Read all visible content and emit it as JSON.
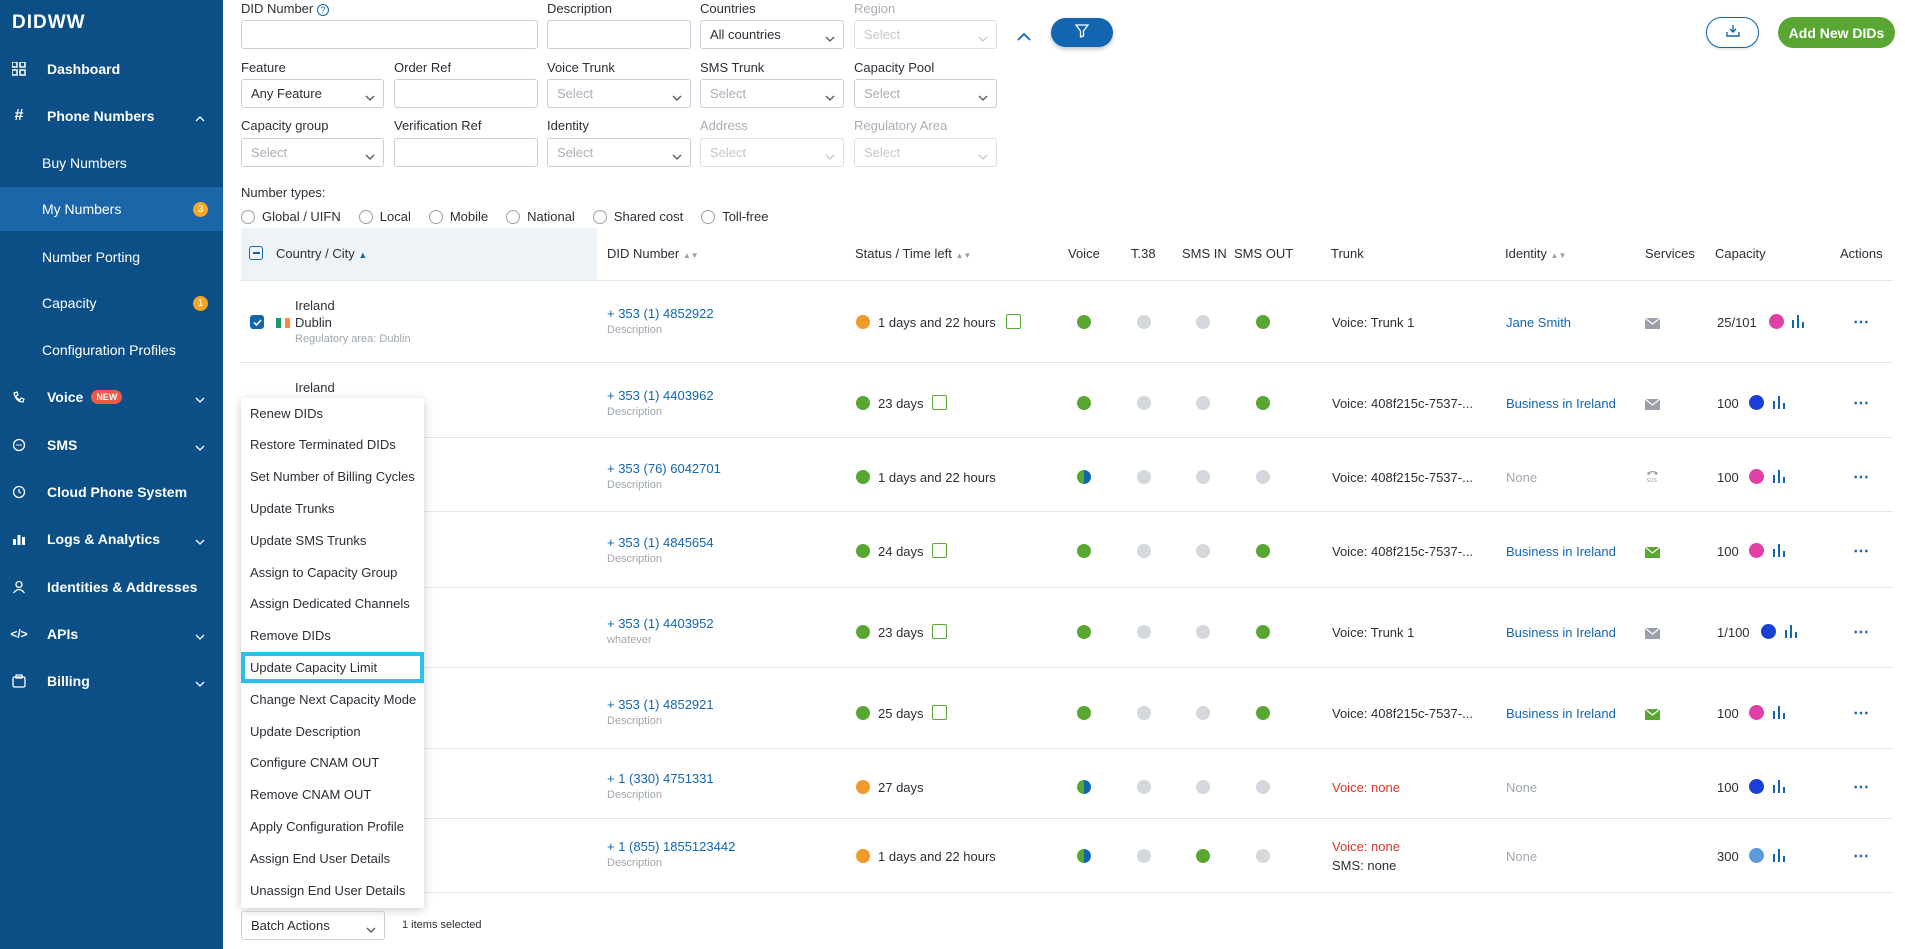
{
  "brand": "DIDWW",
  "sidebar": {
    "items": [
      {
        "label": "Dashboard"
      },
      {
        "label": "Phone Numbers"
      },
      {
        "label": "Buy Numbers"
      },
      {
        "label": "My Numbers",
        "badge": "3"
      },
      {
        "label": "Number Porting"
      },
      {
        "label": "Capacity",
        "badge": "1"
      },
      {
        "label": "Configuration Profiles"
      },
      {
        "label": "Voice",
        "tag": "NEW"
      },
      {
        "label": "SMS"
      },
      {
        "label": "Cloud Phone System"
      },
      {
        "label": "Logs & Analytics"
      },
      {
        "label": "Identities & Addresses"
      },
      {
        "label": "APIs"
      },
      {
        "label": "Billing"
      }
    ]
  },
  "filters": {
    "did_number": "DID Number",
    "description": "Description",
    "countries": "Countries",
    "countries_value": "All countries",
    "region": "Region",
    "feature": "Feature",
    "feature_value": "Any Feature",
    "order_ref": "Order Ref",
    "voice_trunk": "Voice Trunk",
    "sms_trunk": "SMS Trunk",
    "capacity_pool": "Capacity Pool",
    "capacity_group": "Capacity group",
    "verification_ref": "Verification Ref",
    "identity": "Identity",
    "address": "Address",
    "regulatory_area": "Regulatory Area",
    "select_placeholder": "Select",
    "number_types_label": "Number types:",
    "number_types": [
      "Global / UIFN",
      "Local",
      "Mobile",
      "National",
      "Shared cost",
      "Toll-free"
    ]
  },
  "actions": {
    "add_label": "Add New DIDs"
  },
  "table": {
    "headers": {
      "country": "Country / City",
      "did": "DID Number",
      "status": "Status / Time left",
      "voice": "Voice",
      "t38": "T.38",
      "sms_in": "SMS IN",
      "sms_out": "SMS OUT",
      "trunk": "Trunk",
      "identity": "Identity",
      "services": "Services",
      "capacity": "Capacity",
      "actions": "Actions"
    },
    "rows": [
      {
        "country": "Ireland",
        "city": "Dublin",
        "area": "Regulatory area: Dublin",
        "did": "+ 353 (1) 4852922",
        "desc": "Description",
        "status": "1 days and 22 hours",
        "trunk": "Voice: Trunk 1",
        "trunk2": "",
        "identity": "Jane Smith",
        "capacity": "25/101"
      },
      {
        "country": "Ireland",
        "city": "",
        "area": "",
        "did": "+ 353 (1) 4403962",
        "desc": "Description",
        "status": "23 days",
        "trunk": "Voice: 408f215c-7537-...",
        "trunk2": "",
        "identity": "Business in Ireland",
        "capacity": "100"
      },
      {
        "country": "",
        "city": "",
        "area": "",
        "did": "+ 353 (76) 6042701",
        "desc": "Description",
        "status": "1 days and 22 hours",
        "trunk": "Voice: 408f215c-7537-...",
        "trunk2": "",
        "identity": "None",
        "capacity": "100"
      },
      {
        "country": "",
        "city": "",
        "area": "",
        "did": "+ 353 (1) 4845654",
        "desc": "Description",
        "status": "24 days",
        "trunk": "Voice: 408f215c-7537-...",
        "trunk2": "",
        "identity": "Business in Ireland",
        "capacity": "100"
      },
      {
        "country": "",
        "city": "",
        "area": "",
        "did": "+ 353 (1) 4403952",
        "desc": "whatever",
        "status": "23 days",
        "trunk": "Voice: Trunk 1",
        "trunk2": "",
        "identity": "Business in Ireland",
        "capacity": "1/100"
      },
      {
        "country": "",
        "city": "",
        "area": "",
        "did": "+ 353 (1) 4852921",
        "desc": "Description",
        "status": "25 days",
        "trunk": "Voice: 408f215c-7537-...",
        "trunk2": "",
        "identity": "Business in Ireland",
        "capacity": "100"
      },
      {
        "country": "",
        "city": "",
        "area": "",
        "did": "+ 1 (330) 4751331",
        "desc": "Description",
        "status": "27 days",
        "trunk": "Voice: none",
        "trunk2": "",
        "identity": "None",
        "capacity": "100"
      },
      {
        "country": "",
        "city": "",
        "area": "",
        "did": "+ 1 (855) 1855123442",
        "desc": "Description",
        "status": "1 days and 22 hours",
        "trunk": "Voice: none",
        "trunk2": "SMS: none",
        "identity": "None",
        "capacity": "300"
      }
    ]
  },
  "batch_menu": {
    "items": [
      "Renew DIDs",
      "Restore Terminated DIDs",
      "Set Number of Billing Cycles",
      "Update Trunks",
      "Update SMS Trunks",
      "Assign to Capacity Group",
      "Assign Dedicated Channels",
      "Remove DIDs",
      "Update Capacity Limit",
      "Change Next Capacity Mode",
      "Update Description",
      "Configure CNAM OUT",
      "Remove CNAM OUT",
      "Apply Configuration Profile",
      "Assign End User Details",
      "Unassign End User Details"
    ],
    "highlighted": "Update Capacity Limit"
  },
  "footer": {
    "batch_label": "Batch Actions",
    "selected_text": "1 items selected"
  },
  "colors": {
    "sidebar": "#0b4f86",
    "accent": "#1266b0",
    "green": "#5aa632",
    "orange": "#f09a2c",
    "highlight": "#29c1ea"
  }
}
